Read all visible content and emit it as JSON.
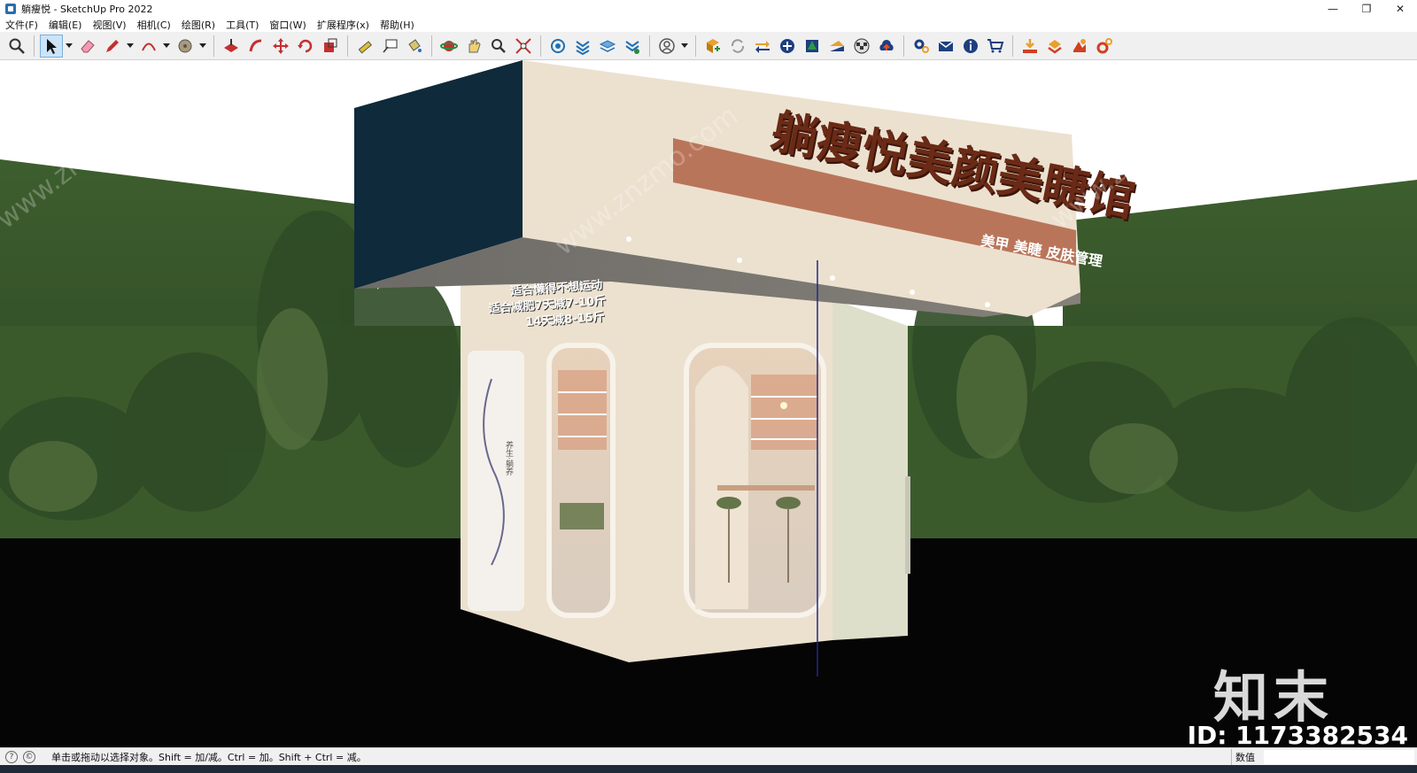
{
  "window": {
    "title": "躺瘦悦 - SketchUp Pro 2022",
    "minimize_glyph": "—",
    "maximize_glyph": "❐",
    "close_glyph": "✕"
  },
  "menu": [
    "文件(F)",
    "编辑(E)",
    "视图(V)",
    "相机(C)",
    "绘图(R)",
    "工具(T)",
    "窗口(W)",
    "扩展程序(x)",
    "帮助(H)"
  ],
  "toolbar": {
    "groups": [
      [
        "zoom-icon"
      ],
      [
        "select-arrow-icon",
        "eraser-icon",
        "pencil-icon",
        "arc-icon",
        "circle-icon"
      ],
      [
        "push-pull-icon",
        "follow-me-icon",
        "move-icon",
        "rotate-icon",
        "scale-icon"
      ],
      [
        "tape-measure-icon",
        "text-label-icon",
        "paint-bucket-icon"
      ],
      [
        "orbit-icon",
        "pan-icon",
        "magnify-icon",
        "zoom-extents-icon"
      ],
      [
        "warehouse-icon",
        "components-icon",
        "layers-icon",
        "extension-icon"
      ],
      [
        "account-icon"
      ],
      [
        "add-location-icon",
        "refresh-icon",
        "toggle-terrain-icon",
        "plus-circle-icon",
        "tree-icon",
        "shadow-icon",
        "checker-icon",
        "cloud-upload-icon"
      ],
      [
        "settings-icon",
        "mail-icon",
        "info-icon",
        "cart-icon"
      ],
      [
        "import-icon",
        "export-icon",
        "plugin-icon",
        "gear-plugin-icon"
      ]
    ]
  },
  "scene": {
    "signboard_title": "躺瘦悦美颜美睫馆",
    "signboard_subtitle": "美甲 美睫 皮肤管理",
    "promo_lines": [
      "适合懒得不想运动",
      "适合减肥7天减7-10斤",
      "14天减8-15斤"
    ],
    "panel_text": "养生·躺养",
    "colors": {
      "sky": "#ffffff",
      "hill": "#3a5a2c",
      "ground": "#050505",
      "facade": "#ece1cf",
      "fascia_dark": "#0f2a3a",
      "accent_stripe": "#b9755a"
    }
  },
  "watermark": {
    "logo": "知末",
    "id": "ID: 1173382534",
    "site": "www.znzmo.com"
  },
  "status": {
    "hint": "单击或拖动以选择对象。Shift = 加/减。Ctrl = 加。Shift + Ctrl = 减。",
    "value_label": "数值",
    "value": ""
  }
}
